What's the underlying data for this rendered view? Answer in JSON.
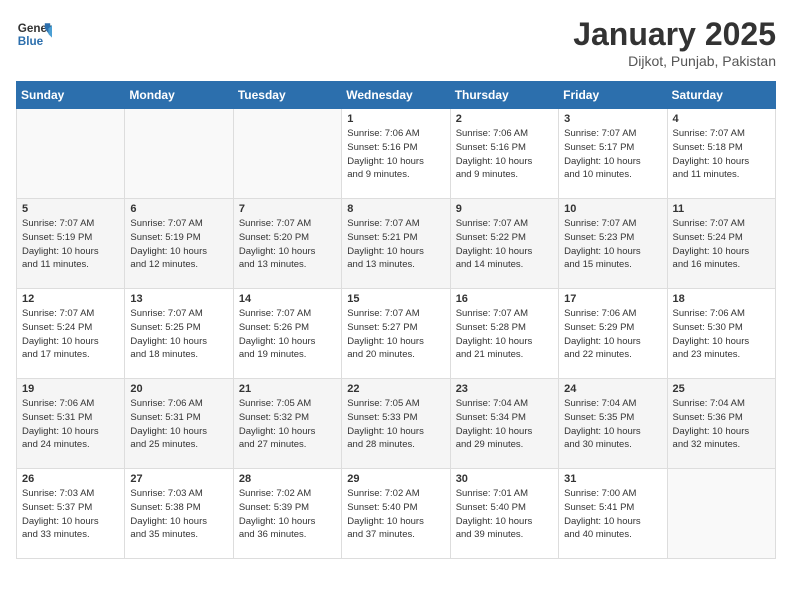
{
  "header": {
    "logo_line1": "General",
    "logo_line2": "Blue",
    "title": "January 2025",
    "subtitle": "Dijkot, Punjab, Pakistan"
  },
  "weekdays": [
    "Sunday",
    "Monday",
    "Tuesday",
    "Wednesday",
    "Thursday",
    "Friday",
    "Saturday"
  ],
  "weeks": [
    [
      {
        "day": "",
        "info": ""
      },
      {
        "day": "",
        "info": ""
      },
      {
        "day": "",
        "info": ""
      },
      {
        "day": "1",
        "info": "Sunrise: 7:06 AM\nSunset: 5:16 PM\nDaylight: 10 hours\nand 9 minutes."
      },
      {
        "day": "2",
        "info": "Sunrise: 7:06 AM\nSunset: 5:16 PM\nDaylight: 10 hours\nand 9 minutes."
      },
      {
        "day": "3",
        "info": "Sunrise: 7:07 AM\nSunset: 5:17 PM\nDaylight: 10 hours\nand 10 minutes."
      },
      {
        "day": "4",
        "info": "Sunrise: 7:07 AM\nSunset: 5:18 PM\nDaylight: 10 hours\nand 11 minutes."
      }
    ],
    [
      {
        "day": "5",
        "info": "Sunrise: 7:07 AM\nSunset: 5:19 PM\nDaylight: 10 hours\nand 11 minutes."
      },
      {
        "day": "6",
        "info": "Sunrise: 7:07 AM\nSunset: 5:19 PM\nDaylight: 10 hours\nand 12 minutes."
      },
      {
        "day": "7",
        "info": "Sunrise: 7:07 AM\nSunset: 5:20 PM\nDaylight: 10 hours\nand 13 minutes."
      },
      {
        "day": "8",
        "info": "Sunrise: 7:07 AM\nSunset: 5:21 PM\nDaylight: 10 hours\nand 13 minutes."
      },
      {
        "day": "9",
        "info": "Sunrise: 7:07 AM\nSunset: 5:22 PM\nDaylight: 10 hours\nand 14 minutes."
      },
      {
        "day": "10",
        "info": "Sunrise: 7:07 AM\nSunset: 5:23 PM\nDaylight: 10 hours\nand 15 minutes."
      },
      {
        "day": "11",
        "info": "Sunrise: 7:07 AM\nSunset: 5:24 PM\nDaylight: 10 hours\nand 16 minutes."
      }
    ],
    [
      {
        "day": "12",
        "info": "Sunrise: 7:07 AM\nSunset: 5:24 PM\nDaylight: 10 hours\nand 17 minutes."
      },
      {
        "day": "13",
        "info": "Sunrise: 7:07 AM\nSunset: 5:25 PM\nDaylight: 10 hours\nand 18 minutes."
      },
      {
        "day": "14",
        "info": "Sunrise: 7:07 AM\nSunset: 5:26 PM\nDaylight: 10 hours\nand 19 minutes."
      },
      {
        "day": "15",
        "info": "Sunrise: 7:07 AM\nSunset: 5:27 PM\nDaylight: 10 hours\nand 20 minutes."
      },
      {
        "day": "16",
        "info": "Sunrise: 7:07 AM\nSunset: 5:28 PM\nDaylight: 10 hours\nand 21 minutes."
      },
      {
        "day": "17",
        "info": "Sunrise: 7:06 AM\nSunset: 5:29 PM\nDaylight: 10 hours\nand 22 minutes."
      },
      {
        "day": "18",
        "info": "Sunrise: 7:06 AM\nSunset: 5:30 PM\nDaylight: 10 hours\nand 23 minutes."
      }
    ],
    [
      {
        "day": "19",
        "info": "Sunrise: 7:06 AM\nSunset: 5:31 PM\nDaylight: 10 hours\nand 24 minutes."
      },
      {
        "day": "20",
        "info": "Sunrise: 7:06 AM\nSunset: 5:31 PM\nDaylight: 10 hours\nand 25 minutes."
      },
      {
        "day": "21",
        "info": "Sunrise: 7:05 AM\nSunset: 5:32 PM\nDaylight: 10 hours\nand 27 minutes."
      },
      {
        "day": "22",
        "info": "Sunrise: 7:05 AM\nSunset: 5:33 PM\nDaylight: 10 hours\nand 28 minutes."
      },
      {
        "day": "23",
        "info": "Sunrise: 7:04 AM\nSunset: 5:34 PM\nDaylight: 10 hours\nand 29 minutes."
      },
      {
        "day": "24",
        "info": "Sunrise: 7:04 AM\nSunset: 5:35 PM\nDaylight: 10 hours\nand 30 minutes."
      },
      {
        "day": "25",
        "info": "Sunrise: 7:04 AM\nSunset: 5:36 PM\nDaylight: 10 hours\nand 32 minutes."
      }
    ],
    [
      {
        "day": "26",
        "info": "Sunrise: 7:03 AM\nSunset: 5:37 PM\nDaylight: 10 hours\nand 33 minutes."
      },
      {
        "day": "27",
        "info": "Sunrise: 7:03 AM\nSunset: 5:38 PM\nDaylight: 10 hours\nand 35 minutes."
      },
      {
        "day": "28",
        "info": "Sunrise: 7:02 AM\nSunset: 5:39 PM\nDaylight: 10 hours\nand 36 minutes."
      },
      {
        "day": "29",
        "info": "Sunrise: 7:02 AM\nSunset: 5:40 PM\nDaylight: 10 hours\nand 37 minutes."
      },
      {
        "day": "30",
        "info": "Sunrise: 7:01 AM\nSunset: 5:40 PM\nDaylight: 10 hours\nand 39 minutes."
      },
      {
        "day": "31",
        "info": "Sunrise: 7:00 AM\nSunset: 5:41 PM\nDaylight: 10 hours\nand 40 minutes."
      },
      {
        "day": "",
        "info": ""
      }
    ]
  ]
}
